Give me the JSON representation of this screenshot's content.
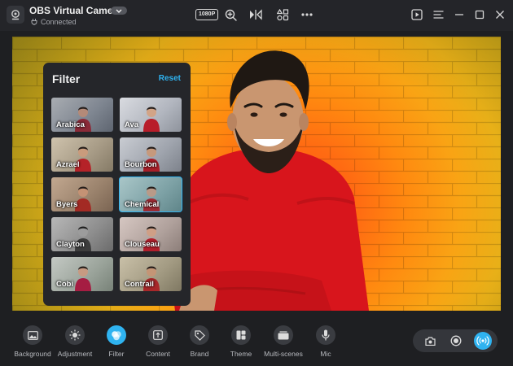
{
  "window": {
    "title": "OBS Virtual Camera",
    "status": "Connected",
    "resolution": "1080P"
  },
  "icons": {
    "app": "webcam-icon",
    "dropdown": "chevron-down-icon",
    "status": "plug-icon",
    "zoom": "zoom-in-icon",
    "mirror": "mirror-flip-icon",
    "layout": "shapes-icon",
    "more": "more-horizontal-icon",
    "play": "play-square-icon",
    "menu": "menu-icon",
    "minimize": "minimize-icon",
    "maximize": "maximize-icon",
    "close": "close-icon"
  },
  "filter_panel": {
    "title": "Filter",
    "reset_label": "Reset",
    "filters": [
      {
        "label": "Arabica"
      },
      {
        "label": "Ava"
      },
      {
        "label": "Azrael"
      },
      {
        "label": "Bourbon"
      },
      {
        "label": "Byers"
      },
      {
        "label": "Chemical",
        "selected": true
      },
      {
        "label": "Clayton"
      },
      {
        "label": "Clouseau"
      },
      {
        "label": "Cobi"
      },
      {
        "label": "Contrail"
      }
    ]
  },
  "toolbar": {
    "items": [
      {
        "label": "Background",
        "icon": "image-icon"
      },
      {
        "label": "Adjustment",
        "icon": "brightness-icon"
      },
      {
        "label": "Filter",
        "icon": "filter-icon",
        "active": true
      },
      {
        "label": "Content",
        "icon": "upload-content-icon"
      },
      {
        "label": "Brand",
        "icon": "tag-icon"
      },
      {
        "label": "Theme",
        "icon": "theme-icon"
      },
      {
        "label": "Multi-scenes",
        "icon": "scenes-icon"
      },
      {
        "label": "Mic",
        "icon": "microphone-icon"
      }
    ],
    "controls": [
      {
        "icon": "camera-snapshot-icon"
      },
      {
        "icon": "record-icon"
      },
      {
        "icon": "broadcast-icon",
        "active": true
      }
    ]
  },
  "colors": {
    "accent": "#2fb3f0",
    "background": "#1e1f22",
    "panel": "#25262a",
    "sweater": "#d8151c"
  }
}
